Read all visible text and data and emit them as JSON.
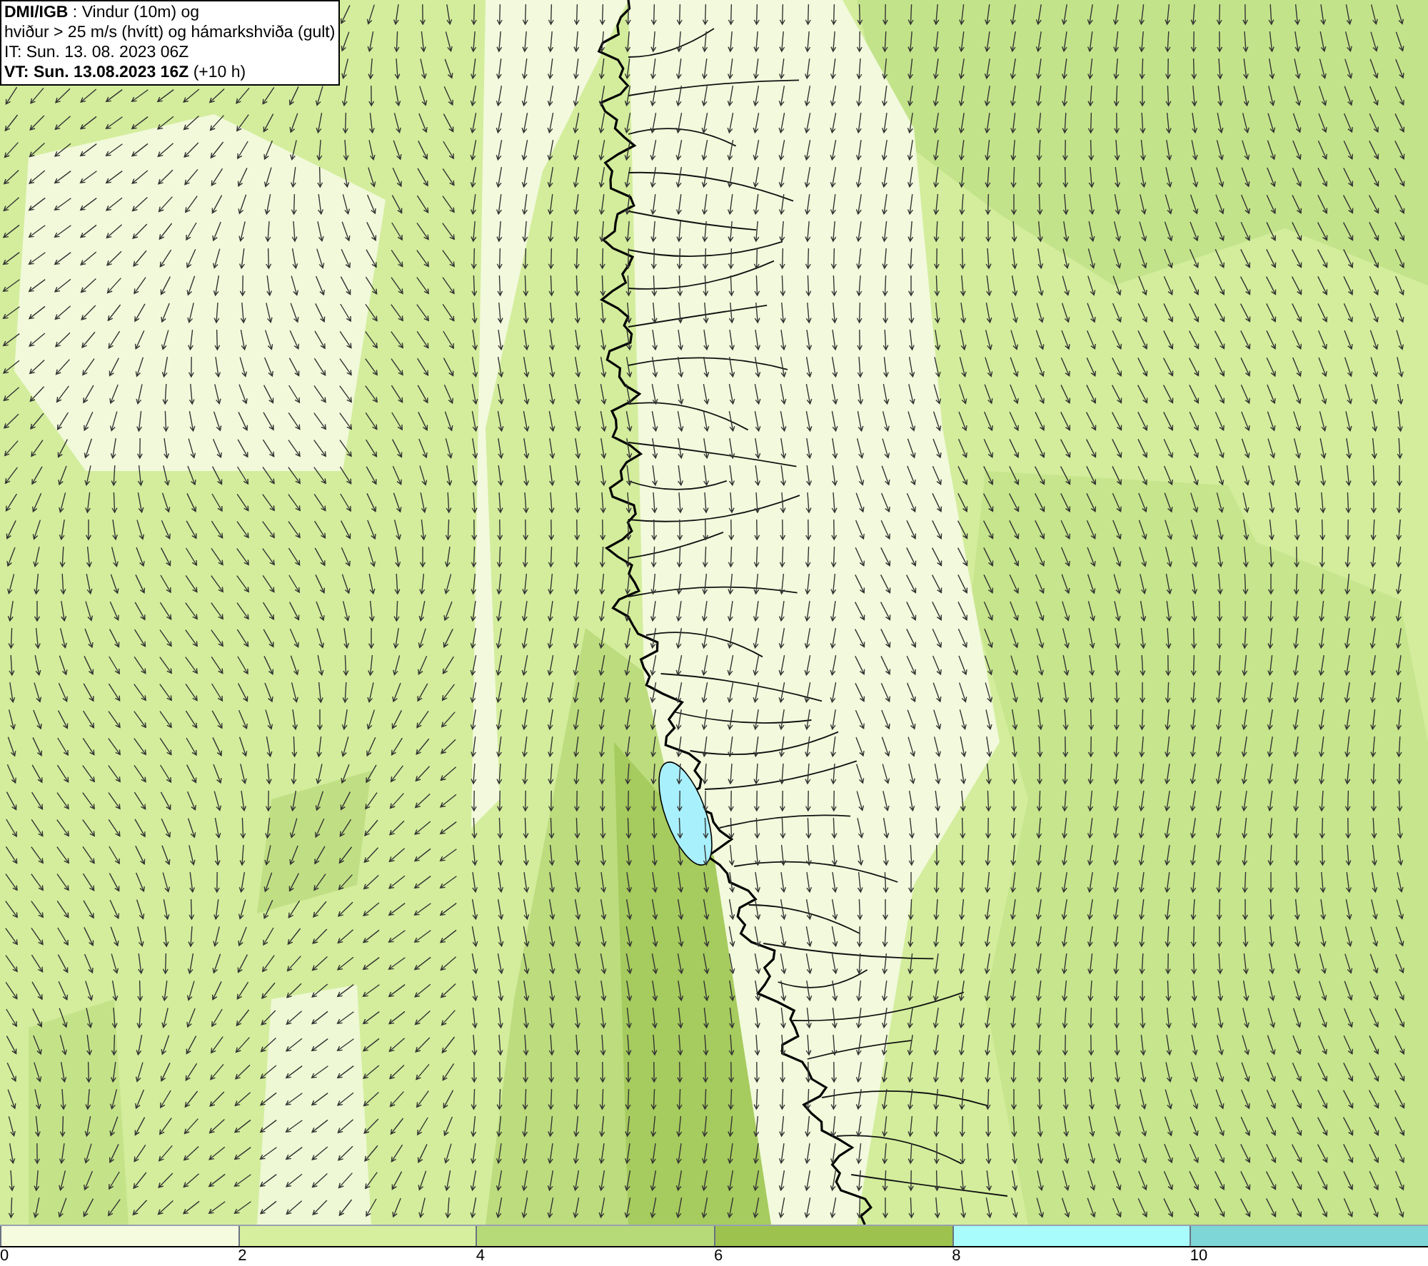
{
  "header": {
    "lines": [
      "**DMI/IGB** : Vindur (10m) og",
      "hviður > 25 m/s (hvítt) og hámarkshviða (gult)",
      "IT: Sun. 13. 08. 2023 06Z",
      "**VT: Sun. 13.08.2023 16Z** (+10 h)"
    ]
  },
  "legend": {
    "bins": [
      {
        "label": "0",
        "color": "#f4fbdf"
      },
      {
        "label": "2",
        "color": "#d6ef9e"
      },
      {
        "label": "4",
        "color": "#b7da79"
      },
      {
        "label": "6",
        "color": "#9dc24e"
      },
      {
        "label": "8",
        "color": "#a8fcfc"
      },
      {
        "label": "10",
        "color": "#7ed6d6"
      }
    ]
  }
}
